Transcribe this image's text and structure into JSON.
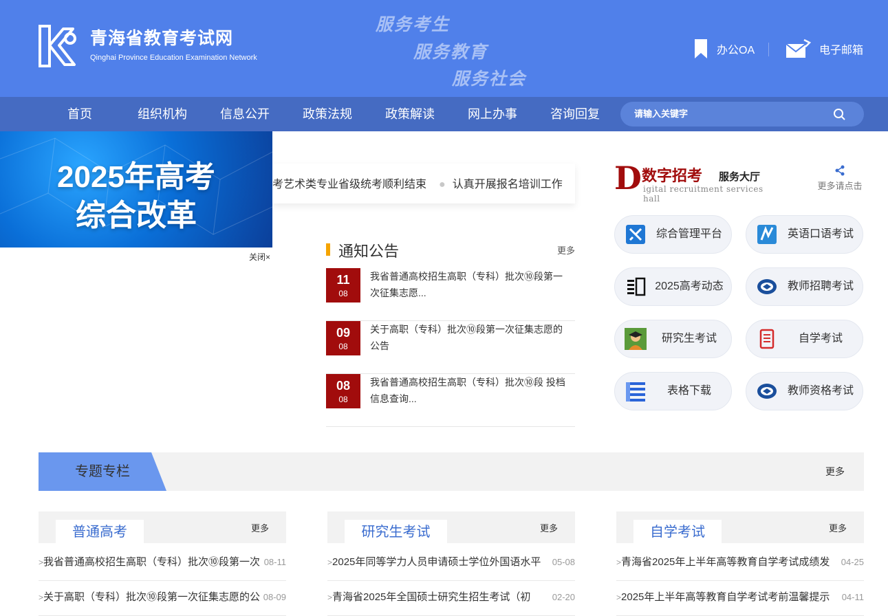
{
  "header": {
    "title": "青海省教育考试网",
    "subtitle": "Qinghai Province Education Examination Network",
    "slogans": [
      "服务考生",
      "服务教育",
      "服务社会"
    ],
    "oa_label": "办公OA",
    "mail_label": "电子邮箱"
  },
  "nav": {
    "items": [
      "首页",
      "组织机构",
      "信息公开",
      "政策法规",
      "政策解读",
      "网上办事",
      "咨询回复"
    ]
  },
  "search": {
    "placeholder": "请输入关键字"
  },
  "float_ad": {
    "line1": "2025年高考",
    "line2": "综合改革",
    "close_label": "关闭×"
  },
  "ticker": {
    "item1": "考艺术类专业省级统考顺利结束",
    "item2": "认真开展报名培训工作"
  },
  "notices": {
    "title": "通知公告",
    "more": "更多",
    "items": [
      {
        "day": "11",
        "month": "08",
        "text": "我省普通高校招生高职（专科）批次⑩段第一次征集志愿..."
      },
      {
        "day": "09",
        "month": "08",
        "text": "关于高职（专科）批次⑩段第一次征集志愿的公告"
      },
      {
        "day": "08",
        "month": "08",
        "text": "我省普通高校招生高职（专科）批次⑩段 投档信息查询..."
      }
    ]
  },
  "service_hall": {
    "logo_letter": "D",
    "logo_cn": "数字招考",
    "logo_cn2": "服务大厅",
    "logo_en": "igital recruitment services hall",
    "share_text": "更多请点击",
    "buttons": [
      "综合管理平台",
      "英语口语考试",
      "2025高考动态",
      "教师招聘考试",
      "研究生考试",
      "自学考试",
      "表格下载",
      "教师资格考试"
    ]
  },
  "topics": {
    "title": "专题专栏",
    "more": "更多"
  },
  "columns": [
    {
      "title": "普通高考",
      "more": "更多",
      "rows": [
        {
          "text": "我省普通高校招生高职（专科）批次⑩段第一次",
          "date": "08-11"
        },
        {
          "text": "关于高职（专科）批次⑩段第一次征集志愿的公",
          "date": "08-09"
        }
      ]
    },
    {
      "title": "研究生考试",
      "more": "更多",
      "rows": [
        {
          "text": "2025年同等学力人员申请硕士学位外国语水平",
          "date": "05-08"
        },
        {
          "text": "青海省2025年全国硕士研究生招生考试（初",
          "date": "02-20"
        }
      ]
    },
    {
      "title": "自学考试",
      "more": "更多",
      "rows": [
        {
          "text": "青海省2025年上半年高等教育自学考试成绩发",
          "date": "04-25"
        },
        {
          "text": "2025年上半年高等教育自学考试考前温馨提示",
          "date": "04-11"
        }
      ]
    }
  ]
}
